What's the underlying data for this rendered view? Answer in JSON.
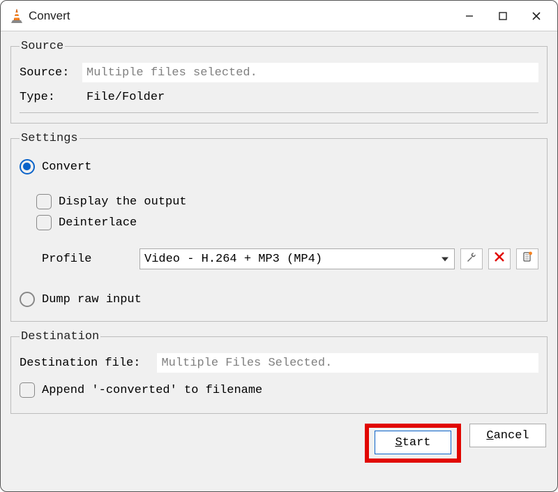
{
  "window": {
    "title": "Convert"
  },
  "source": {
    "legend": "Source",
    "source_label": "Source:",
    "source_value": "Multiple files selected.",
    "type_label": "Type:",
    "type_value": "File/Folder"
  },
  "settings": {
    "legend": "Settings",
    "convert_label": "Convert",
    "display_output_label": "Display the output",
    "deinterlace_label": "Deinterlace",
    "profile_label": "Profile",
    "profile_value": "Video - H.264 + MP3 (MP4)",
    "dump_raw_label": "Dump raw input"
  },
  "destination": {
    "legend": "Destination",
    "file_label": "Destination file:",
    "file_value": "Multiple Files Selected.",
    "append_label": "Append '-converted' to filename"
  },
  "buttons": {
    "start": "Start",
    "cancel": "Cancel"
  }
}
